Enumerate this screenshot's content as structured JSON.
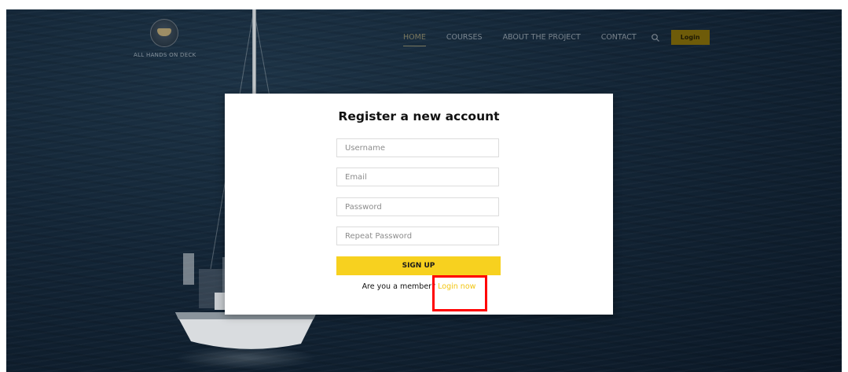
{
  "brand": {
    "logo_text": "ALL HANDS ON DECK"
  },
  "nav": {
    "items": [
      {
        "label": "HOME",
        "active": true
      },
      {
        "label": "COURSES",
        "active": false
      },
      {
        "label": "ABOUT THE PROJECT",
        "active": false
      },
      {
        "label": "CONTACT",
        "active": false
      }
    ],
    "search_icon": "search-icon",
    "login_label": "Login"
  },
  "modal": {
    "title": "Register a new account",
    "username_placeholder": "Username",
    "email_placeholder": "Email",
    "password_placeholder": "Password",
    "repeat_password_placeholder": "Repeat Password",
    "signup_label": "SIGN UP",
    "member_prompt": "Are you a member?",
    "login_link": "Login now"
  },
  "colors": {
    "accent_yellow": "#f7d11f",
    "link_yellow": "#f2c511",
    "highlight_red": "#ff0000",
    "backdrop": "#132536"
  }
}
